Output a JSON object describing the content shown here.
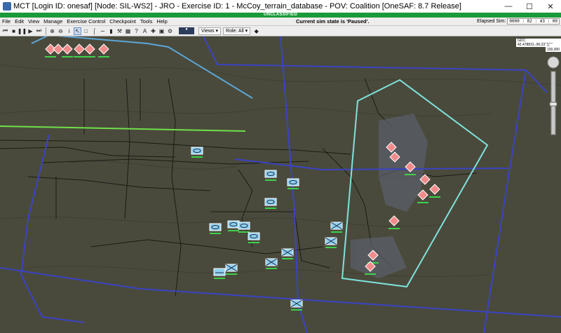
{
  "window": {
    "title": "MCT [Login ID: onesaf] [Node: SIL-WS2] - JRO - Exercise ID: 1 - McCoy_terrain_database - POV: Coalition    [OneSAF: 8.7 Release]"
  },
  "classification": "UNCLASSIFIED",
  "menu": {
    "items": [
      "File",
      "Edit",
      "View",
      "Manage",
      "Exercise Control",
      "Checkpoint",
      "Tools",
      "Help"
    ],
    "status": "Current sim state is 'Paused'.",
    "elapsed_label": "Elapsed Sim:",
    "elapsed_value": "0000 : 02 : 43 : 00"
  },
  "toolbar": {
    "views_label": "Views",
    "role_label": "Role: All"
  },
  "map": {
    "coord_readout": "GDC: 42.478831,-90.231970",
    "scale_readout": "1: 100,000"
  },
  "colors": {
    "terrain": "#4a4a3c",
    "road_blue": "#3b43c4",
    "light_blue": "#5ba7d8",
    "green_line": "#6fe04a",
    "cyan_area": "#7fe3dd",
    "friendly": "#8fd0f0",
    "hostile": "#f08b8b",
    "classification_bar": "#1b9a3a"
  }
}
